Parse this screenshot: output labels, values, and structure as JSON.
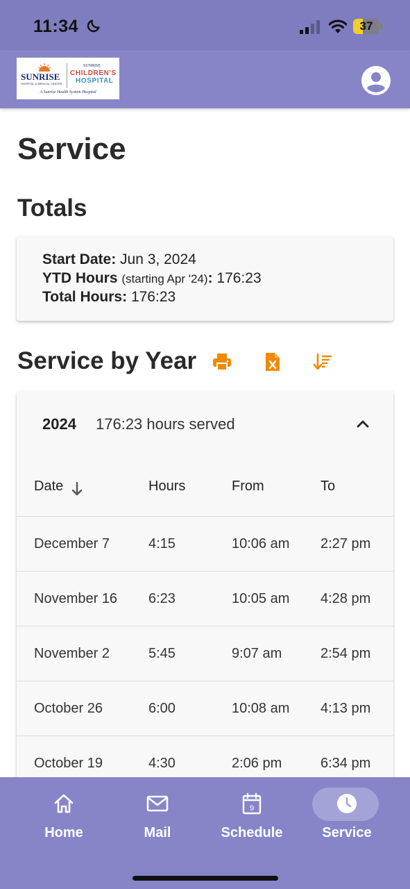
{
  "status_bar": {
    "time": "11:34",
    "battery_percent": "37",
    "battery_level": 0.37
  },
  "header": {
    "logo": {
      "brand": "SUNRISE",
      "brand_sub": "HOSPITAL & MEDICAL CENTER",
      "kids_brand_top": "SUNRISE",
      "kids_line1": "CHILDREN'S",
      "kids_line2": "HOSPITAL",
      "tagline": "A Sunrise Health System Hospital"
    },
    "account_icon": "account-circle-icon"
  },
  "page": {
    "title": "Service",
    "totals_heading": "Totals",
    "totals": {
      "start_date_label": "Start Date:",
      "start_date_value": "Jun 3, 2024",
      "ytd_label": "YTD Hours",
      "ytd_note": "(starting Apr '24)",
      "ytd_colon": ":",
      "ytd_value": "176:23",
      "total_label": "Total Hours:",
      "total_value": "176:23"
    },
    "by_year_heading": "Service by Year",
    "tools": [
      "print-icon",
      "excel-file-icon",
      "sort-icon"
    ]
  },
  "year_panel": {
    "year": "2024",
    "summary": "176:23 hours served",
    "expanded": true,
    "columns": [
      "Date",
      "Hours",
      "From",
      "To"
    ],
    "rows": [
      [
        "December 7",
        "4:15",
        "10:06 am",
        "2:27 pm"
      ],
      [
        "November 16",
        "6:23",
        "10:05 am",
        "4:28 pm"
      ],
      [
        "November 2",
        "5:45",
        "9:07 am",
        "2:54 pm"
      ],
      [
        "October 26",
        "6:00",
        "10:08 am",
        "4:13 pm"
      ],
      [
        "October 19",
        "4:30",
        "2:06 pm",
        "6:34 pm"
      ]
    ]
  },
  "tabbar": {
    "tabs": [
      {
        "label": "Home",
        "icon": "home-icon"
      },
      {
        "label": "Mail",
        "icon": "mail-icon"
      },
      {
        "label": "Schedule",
        "icon": "calendar-icon",
        "icon_text": "9"
      },
      {
        "label": "Service",
        "icon": "clock-icon",
        "active": true
      }
    ]
  },
  "colors": {
    "header": "#8785c8",
    "accent": "#f08a00",
    "tab_active_pill": "#a4a3d7"
  }
}
